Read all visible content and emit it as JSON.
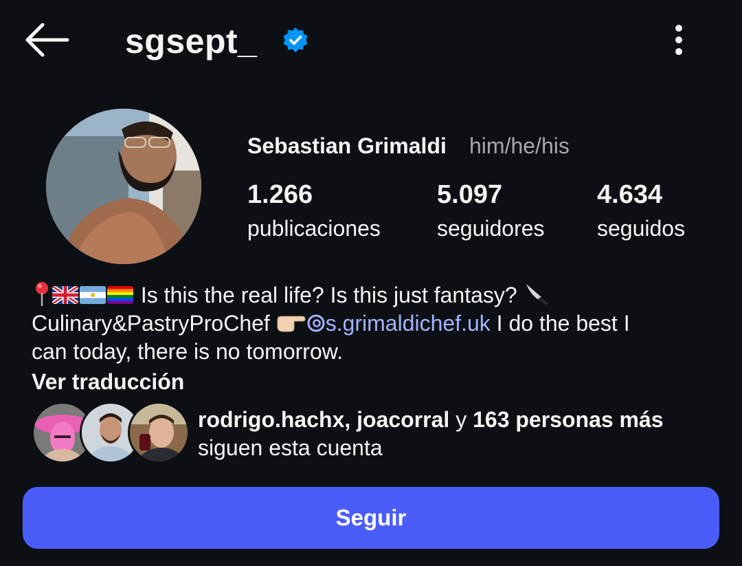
{
  "header": {
    "username": "sgsept_",
    "verified": true,
    "back_icon": "arrow-left-icon",
    "more_icon": "more-vertical-icon"
  },
  "profile": {
    "full_name": "Sebastian Grimaldi",
    "pronouns": "him/he/his",
    "stats": {
      "posts_count": "1.266",
      "posts_label": "publicaciones",
      "followers_count": "5.097",
      "followers_label": "seguidores",
      "following_count": "4.634",
      "following_label": "seguidos"
    }
  },
  "bio": {
    "line1_text": "Is this the real life? Is this just fantasy?",
    "line2_text": "Culinary&PastryProChef",
    "threads_handle": "s.grimaldichef.uk",
    "line2_rest": "I do the best I",
    "line3_text": "can today, there is no tomorrow.",
    "translate_label": "Ver traducción",
    "emojis": [
      "pin-icon",
      "uk-flag-icon",
      "argentina-flag-icon",
      "rainbow-flag-icon",
      "knife-icon",
      "pointing-hand-icon",
      "threads-icon"
    ]
  },
  "followed_by": {
    "names": "rodrigo.hachx, joacorral",
    "connector": "y",
    "others": "163 personas más",
    "suffix": "siguen esta cuenta"
  },
  "actions": {
    "follow_label": "Seguir"
  },
  "colors": {
    "background": "#0c1014",
    "accent_button": "#4a5df9",
    "link": "#a3b4ff",
    "verified_badge": "#0095f6",
    "secondary_text": "#a8a8a8"
  }
}
